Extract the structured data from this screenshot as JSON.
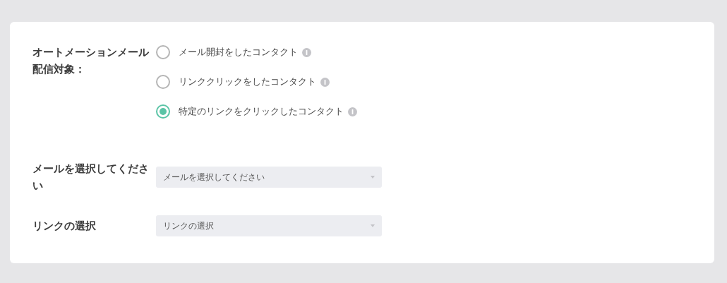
{
  "target": {
    "label": "オートメーションメール配信対象：",
    "options": [
      {
        "label": "メール開封をしたコンタクト",
        "selected": false
      },
      {
        "label": "リンククリックをしたコンタクト",
        "selected": false
      },
      {
        "label": "特定のリンクをクリックしたコンタクト",
        "selected": true
      }
    ]
  },
  "selects": [
    {
      "label": "メールを選択してください",
      "placeholder": "メールを選択してください"
    },
    {
      "label": "リンクの選択",
      "placeholder": "リンクの選択"
    }
  ]
}
